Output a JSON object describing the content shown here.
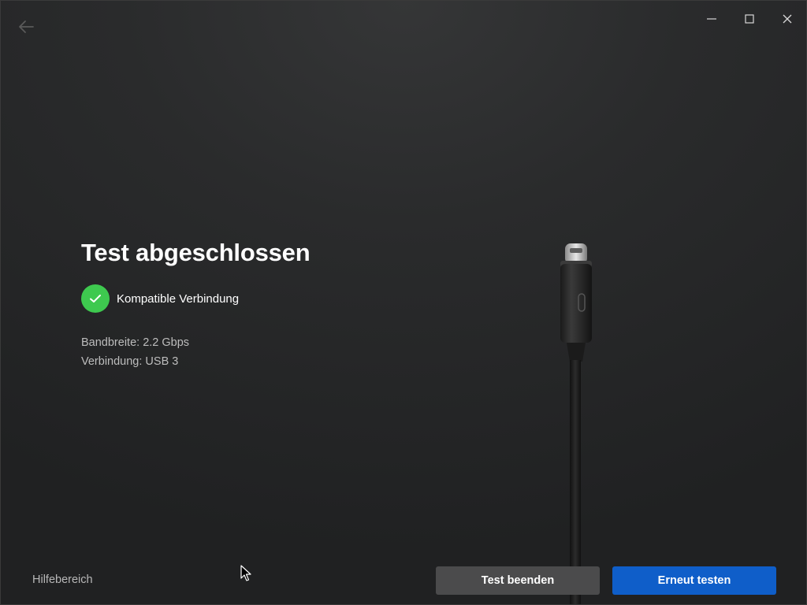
{
  "window": {
    "controls": {
      "minimize_icon": "minimize-icon",
      "maximize_icon": "maximize-icon",
      "close_icon": "close-icon"
    },
    "back_icon": "arrow-left-icon"
  },
  "main": {
    "title": "Test abgeschlossen",
    "status": {
      "icon": "check-icon",
      "text": "Kompatible Verbindung",
      "color": "#3ec94f"
    },
    "details": {
      "bandwidth": "Bandbreite: 2.2 Gbps",
      "connection": "Verbindung: USB 3"
    }
  },
  "footer": {
    "help_link": "Hilfebereich",
    "end_test_label": "Test beenden",
    "retest_label": "Erneut testen"
  },
  "colors": {
    "primary": "#0f5ec9",
    "secondary": "#4b4b4c",
    "success": "#3ec94f"
  }
}
